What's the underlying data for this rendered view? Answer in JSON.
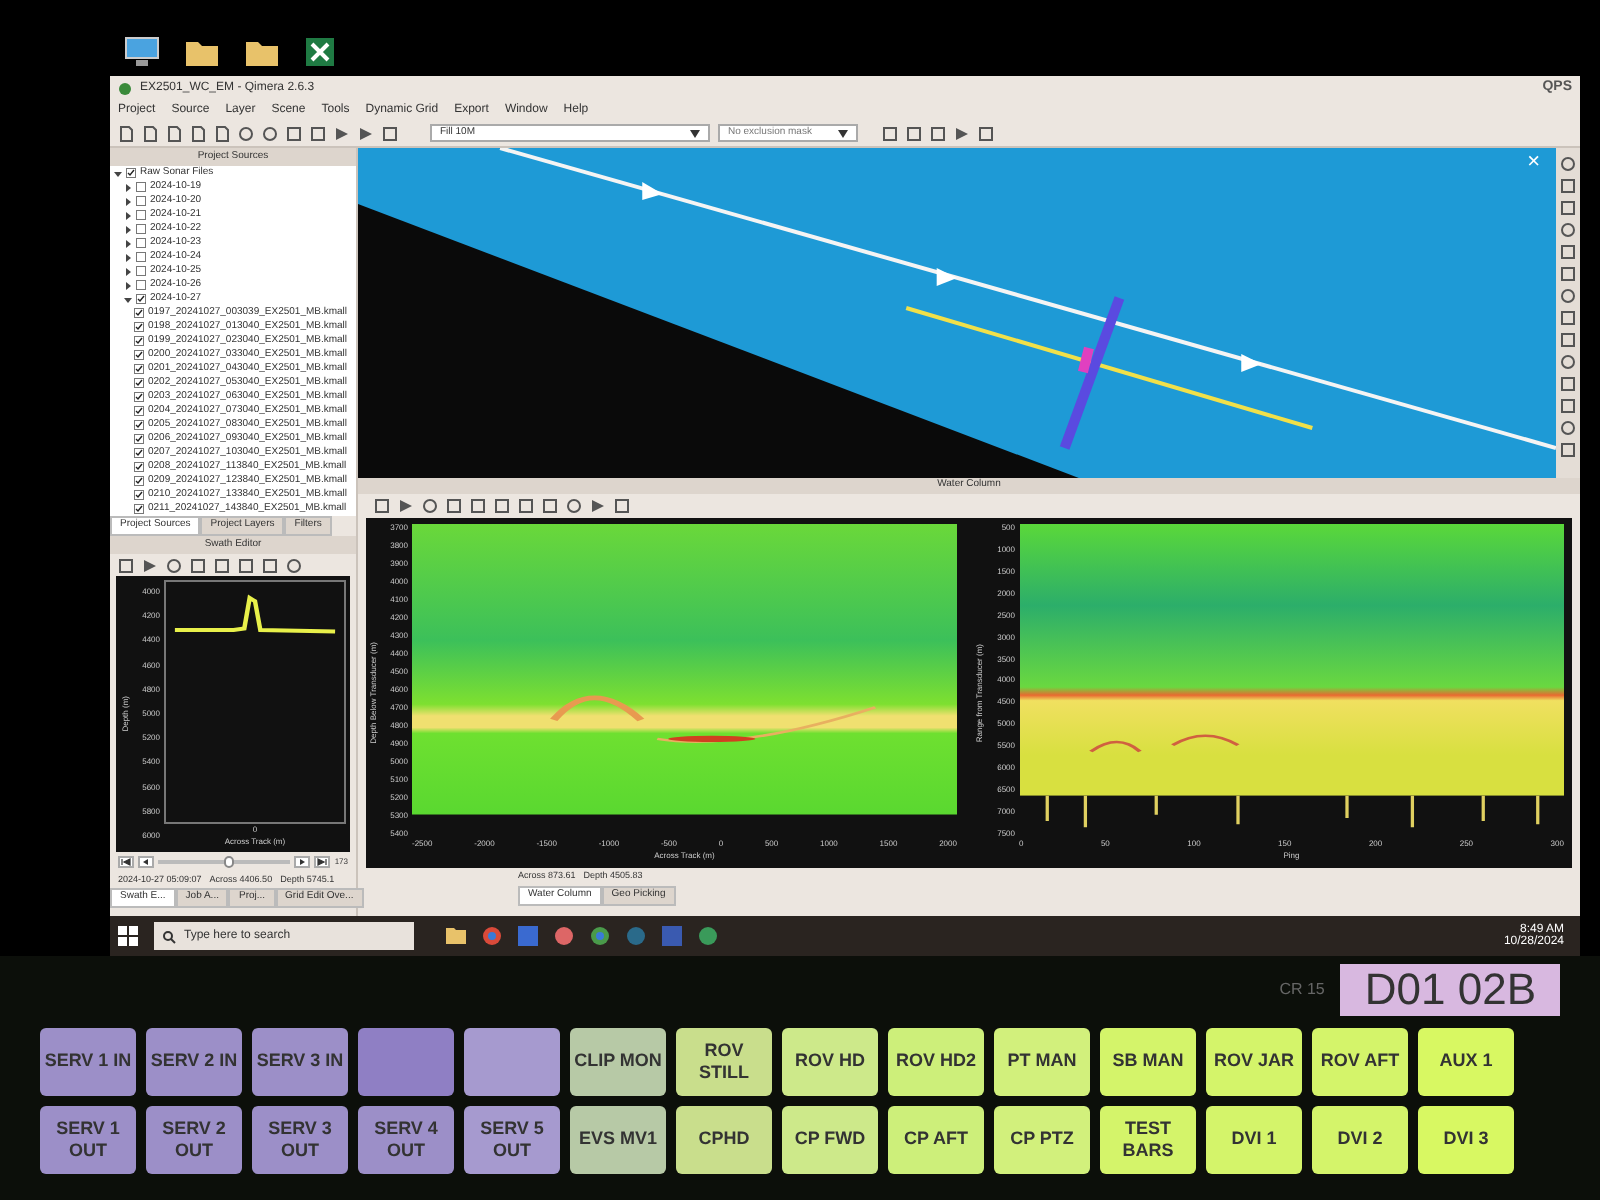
{
  "window": {
    "title": "EX2501_WC_EM - Qimera 2.6.3",
    "logo": "QPS"
  },
  "menu": [
    "Project",
    "Source",
    "Layer",
    "Scene",
    "Tools",
    "Dynamic Grid",
    "Export",
    "Window",
    "Help"
  ],
  "toolbar": {
    "surface_combo": "Fill 10M",
    "mask_combo": "No exclusion mask"
  },
  "project_sources": {
    "title": "Project Sources",
    "tree": [
      {
        "label": "Raw Sonar Files",
        "checked": true,
        "expanded": true,
        "children": [
          {
            "label": "2024-10-19",
            "checked": false,
            "expanded": false
          },
          {
            "label": "2024-10-20",
            "checked": false,
            "expanded": false
          },
          {
            "label": "2024-10-21",
            "checked": false,
            "expanded": false
          },
          {
            "label": "2024-10-22",
            "checked": false,
            "expanded": false
          },
          {
            "label": "2024-10-23",
            "checked": false,
            "expanded": false
          },
          {
            "label": "2024-10-24",
            "checked": false,
            "expanded": false
          },
          {
            "label": "2024-10-25",
            "checked": false,
            "expanded": false
          },
          {
            "label": "2024-10-26",
            "checked": false,
            "expanded": false
          },
          {
            "label": "2024-10-27",
            "checked": true,
            "expanded": true,
            "children": [
              {
                "label": "0197_20241027_003039_EX2501_MB.kmall",
                "checked": true
              },
              {
                "label": "0198_20241027_013040_EX2501_MB.kmall",
                "checked": true
              },
              {
                "label": "0199_20241027_023040_EX2501_MB.kmall",
                "checked": true
              },
              {
                "label": "0200_20241027_033040_EX2501_MB.kmall",
                "checked": true
              },
              {
                "label": "0201_20241027_043040_EX2501_MB.kmall",
                "checked": true
              },
              {
                "label": "0202_20241027_053040_EX2501_MB.kmall",
                "checked": true
              },
              {
                "label": "0203_20241027_063040_EX2501_MB.kmall",
                "checked": true
              },
              {
                "label": "0204_20241027_073040_EX2501_MB.kmall",
                "checked": true
              },
              {
                "label": "0205_20241027_083040_EX2501_MB.kmall",
                "checked": true
              },
              {
                "label": "0206_20241027_093040_EX2501_MB.kmall",
                "checked": true
              },
              {
                "label": "0207_20241027_103040_EX2501_MB.kmall",
                "checked": true
              },
              {
                "label": "0208_20241027_113840_EX2501_MB.kmall",
                "checked": true
              },
              {
                "label": "0209_20241027_123840_EX2501_MB.kmall",
                "checked": true
              },
              {
                "label": "0210_20241027_133840_EX2501_MB.kmall",
                "checked": true
              },
              {
                "label": "0211_20241027_143840_EX2501_MB.kmall",
                "checked": true
              }
            ]
          }
        ]
      }
    ]
  },
  "left_tabs": [
    {
      "label": "Project Sources",
      "selected": true
    },
    {
      "label": "Project Layers",
      "selected": false
    },
    {
      "label": "Filters",
      "selected": false
    }
  ],
  "swath_editor": {
    "title": "Swath Editor",
    "yticks": [
      "4000",
      "4200",
      "4400",
      "4600",
      "4800",
      "5000",
      "5200",
      "5400",
      "5600",
      "5800",
      "6000"
    ],
    "xtick": "0",
    "xlabel": "Across Track (m)",
    "ylabel": "Depth (m)",
    "slider": {
      "level": 0.55,
      "reading": "173"
    },
    "status": [
      "2024-10-27 05:09:07",
      "Across 4406.50",
      "Depth 5745.1"
    ]
  },
  "bottom_left_tabs": [
    {
      "label": "Swath E...",
      "selected": true
    },
    {
      "label": "Job A...",
      "selected": false
    },
    {
      "label": "Proj...",
      "selected": false
    },
    {
      "label": "Grid Edit Ove...",
      "selected": false
    }
  ],
  "map": {
    "close": "×"
  },
  "water_column": {
    "title": "Water Column",
    "charts": [
      {
        "ylabel": "Depth Below Transducer (m)",
        "xlabel": "Across Track (m)",
        "yticks": [
          "3700",
          "3800",
          "3900",
          "4000",
          "4100",
          "4200",
          "4300",
          "4400",
          "4500",
          "4600",
          "4700",
          "4800",
          "4900",
          "5000",
          "5100",
          "5200",
          "5300",
          "5400"
        ],
        "xticks": [
          "-2500",
          "-2000",
          "-1500",
          "-1000",
          "-500",
          "0",
          "500",
          "1000",
          "1500",
          "2000"
        ]
      },
      {
        "ylabel": "Range from Transducer (m)",
        "xlabel": "Ping",
        "yticks": [
          "500",
          "1000",
          "1500",
          "2000",
          "2500",
          "3000",
          "3500",
          "4000",
          "4500",
          "5000",
          "5500",
          "6000",
          "6500",
          "7000",
          "7500"
        ],
        "xticks": [
          "0",
          "50",
          "100",
          "150",
          "200",
          "250",
          "300"
        ]
      }
    ],
    "status": [
      "Across 873.61",
      "Depth 4505.83"
    ]
  },
  "bottom_right_tabs": [
    {
      "label": "Water Column",
      "selected": true
    },
    {
      "label": "Geo Picking",
      "selected": false
    }
  ],
  "taskbar": {
    "search": "Type here to search",
    "time": "8:49 AM",
    "date": "10/28/2024"
  },
  "router_panel": {
    "display": "D01 02B",
    "panel_label": "CR 15",
    "rows": [
      [
        {
          "label": "SERV 1 IN",
          "color": "#9c8fc8"
        },
        {
          "label": "SERV 2 IN",
          "color": "#9c8fc8"
        },
        {
          "label": "SERV 3 IN",
          "color": "#9c8fc8"
        },
        {
          "color": "#8f7fc4"
        },
        {
          "color": "#a69acf"
        },
        {
          "label": "CLIP MON",
          "color": "#b7c9a6"
        },
        {
          "label": "ROV STILL",
          "color": "#c9de8c"
        },
        {
          "label": "ROV HD",
          "color": "#cde98a"
        },
        {
          "label": "ROV HD2",
          "color": "#cdef7a"
        },
        {
          "label": "PT MAN",
          "color": "#d2f07c"
        },
        {
          "label": "SB MAN",
          "color": "#d4f46a"
        },
        {
          "label": "ROV JAR",
          "color": "#d4f46a"
        },
        {
          "label": "ROV AFT",
          "color": "#d4f46a"
        },
        {
          "label": "AUX 1",
          "color": "#d8f862"
        }
      ],
      [
        {
          "label": "SERV 1 OUT",
          "color": "#9c8fc8"
        },
        {
          "label": "SERV 2 OUT",
          "color": "#9c8fc8"
        },
        {
          "label": "SERV 3 OUT",
          "color": "#9c8fc8"
        },
        {
          "label": "SERV 4 OUT",
          "color": "#9c8fc8"
        },
        {
          "label": "SERV 5 OUT",
          "color": "#a69acf"
        },
        {
          "label": "EVS MV1",
          "color": "#b7c9a6"
        },
        {
          "label": "CPHD",
          "color": "#c9de8c"
        },
        {
          "label": "CP FWD",
          "color": "#cde98a"
        },
        {
          "label": "CP AFT",
          "color": "#cdef7a"
        },
        {
          "label": "CP PTZ",
          "color": "#d2f07c"
        },
        {
          "label": "TEST BARS",
          "color": "#d4f46a"
        },
        {
          "label": "DVI 1",
          "color": "#d4f46a"
        },
        {
          "label": "DVI 2",
          "color": "#d4f46a"
        },
        {
          "label": "DVI 3",
          "color": "#d8f862"
        }
      ]
    ]
  }
}
